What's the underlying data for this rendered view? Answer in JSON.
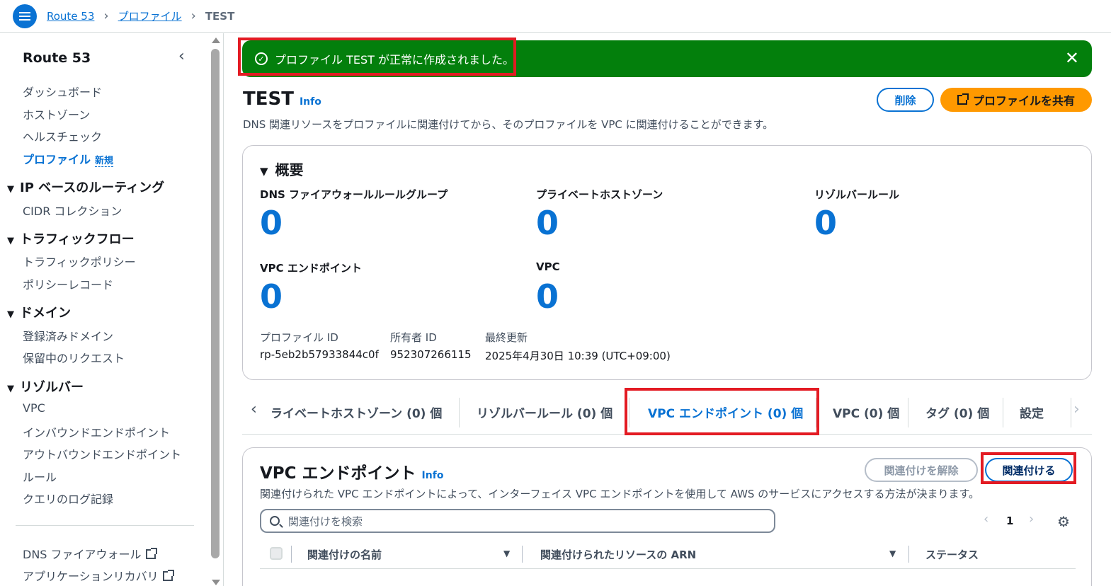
{
  "breadcrumb": {
    "root": "Route 53",
    "parent": "プロファイル",
    "current": "TEST"
  },
  "sidebar": {
    "title": "Route 53",
    "items": [
      "ダッシュボード",
      "ホストゾーン",
      "ヘルスチェック"
    ],
    "active_item": "プロファイル",
    "new_badge": "新規",
    "sections": [
      {
        "title": "IP ベースのルーティング",
        "items": [
          "CIDR コレクション"
        ]
      },
      {
        "title": "トラフィックフロー",
        "items": [
          "トラフィックポリシー",
          "ポリシーレコード"
        ]
      },
      {
        "title": "ドメイン",
        "items": [
          "登録済みドメイン",
          "保留中のリクエスト"
        ]
      },
      {
        "title": "リゾルバー",
        "items": [
          "VPC",
          "インバウンドエンドポイント",
          "アウトバウンドエンドポイント",
          "ルール",
          "クエリのログ記録"
        ]
      }
    ],
    "external_links": [
      "DNS ファイアウォール",
      "アプリケーションリカバリ"
    ]
  },
  "flash": {
    "message": "プロファイル TEST が正常に作成されました。"
  },
  "header": {
    "title": "TEST",
    "info": "Info",
    "description": "DNS 関連リソースをプロファイルに関連付けてから、そのプロファイルを VPC に関連付けることができます。",
    "delete_label": "削除",
    "share_label": "プロファイルを共有"
  },
  "overview": {
    "title": "概要",
    "metrics": [
      {
        "label": "DNS ファイアウォールルールグループ",
        "value": "0"
      },
      {
        "label": "プライベートホストゾーン",
        "value": "0"
      },
      {
        "label": "リゾルバールール",
        "value": "0"
      },
      {
        "label": "VPC エンドポイント",
        "value": "0"
      },
      {
        "label": "VPC",
        "value": "0"
      }
    ],
    "profile_id_label": "プロファイル ID",
    "profile_id": "rp-5eb2b57933844c0f",
    "owner_id_label": "所有者 ID",
    "owner_id": "952307266115",
    "updated_label": "最終更新",
    "updated": "2025年4月30日 10:39 (UTC+09:00)"
  },
  "tabs": [
    "ライベートホストゾーン (0) 個",
    "リゾルバールール (0) 個",
    "VPC エンドポイント (0) 個",
    "VPC (0) 個",
    "タグ (0) 個",
    "設定"
  ],
  "endpoints": {
    "title": "VPC エンドポイント",
    "info": "Info",
    "description": "関連付けられた VPC エンドポイントによって、インターフェイス VPC エンドポイントを使用して AWS のサービスにアクセスする方法が決まります。",
    "disassociate_label": "関連付けを解除",
    "associate_label": "関連付ける",
    "search_placeholder": "関連付けを検索",
    "page": "1",
    "columns": [
      "関連付けの名前",
      "関連付けられたリソースの ARN",
      "ステータス"
    ]
  },
  "colors": {
    "accent": "#0972d3",
    "success": "#037f0c",
    "primary_button": "#ff9900",
    "highlight": "#e31b23"
  }
}
